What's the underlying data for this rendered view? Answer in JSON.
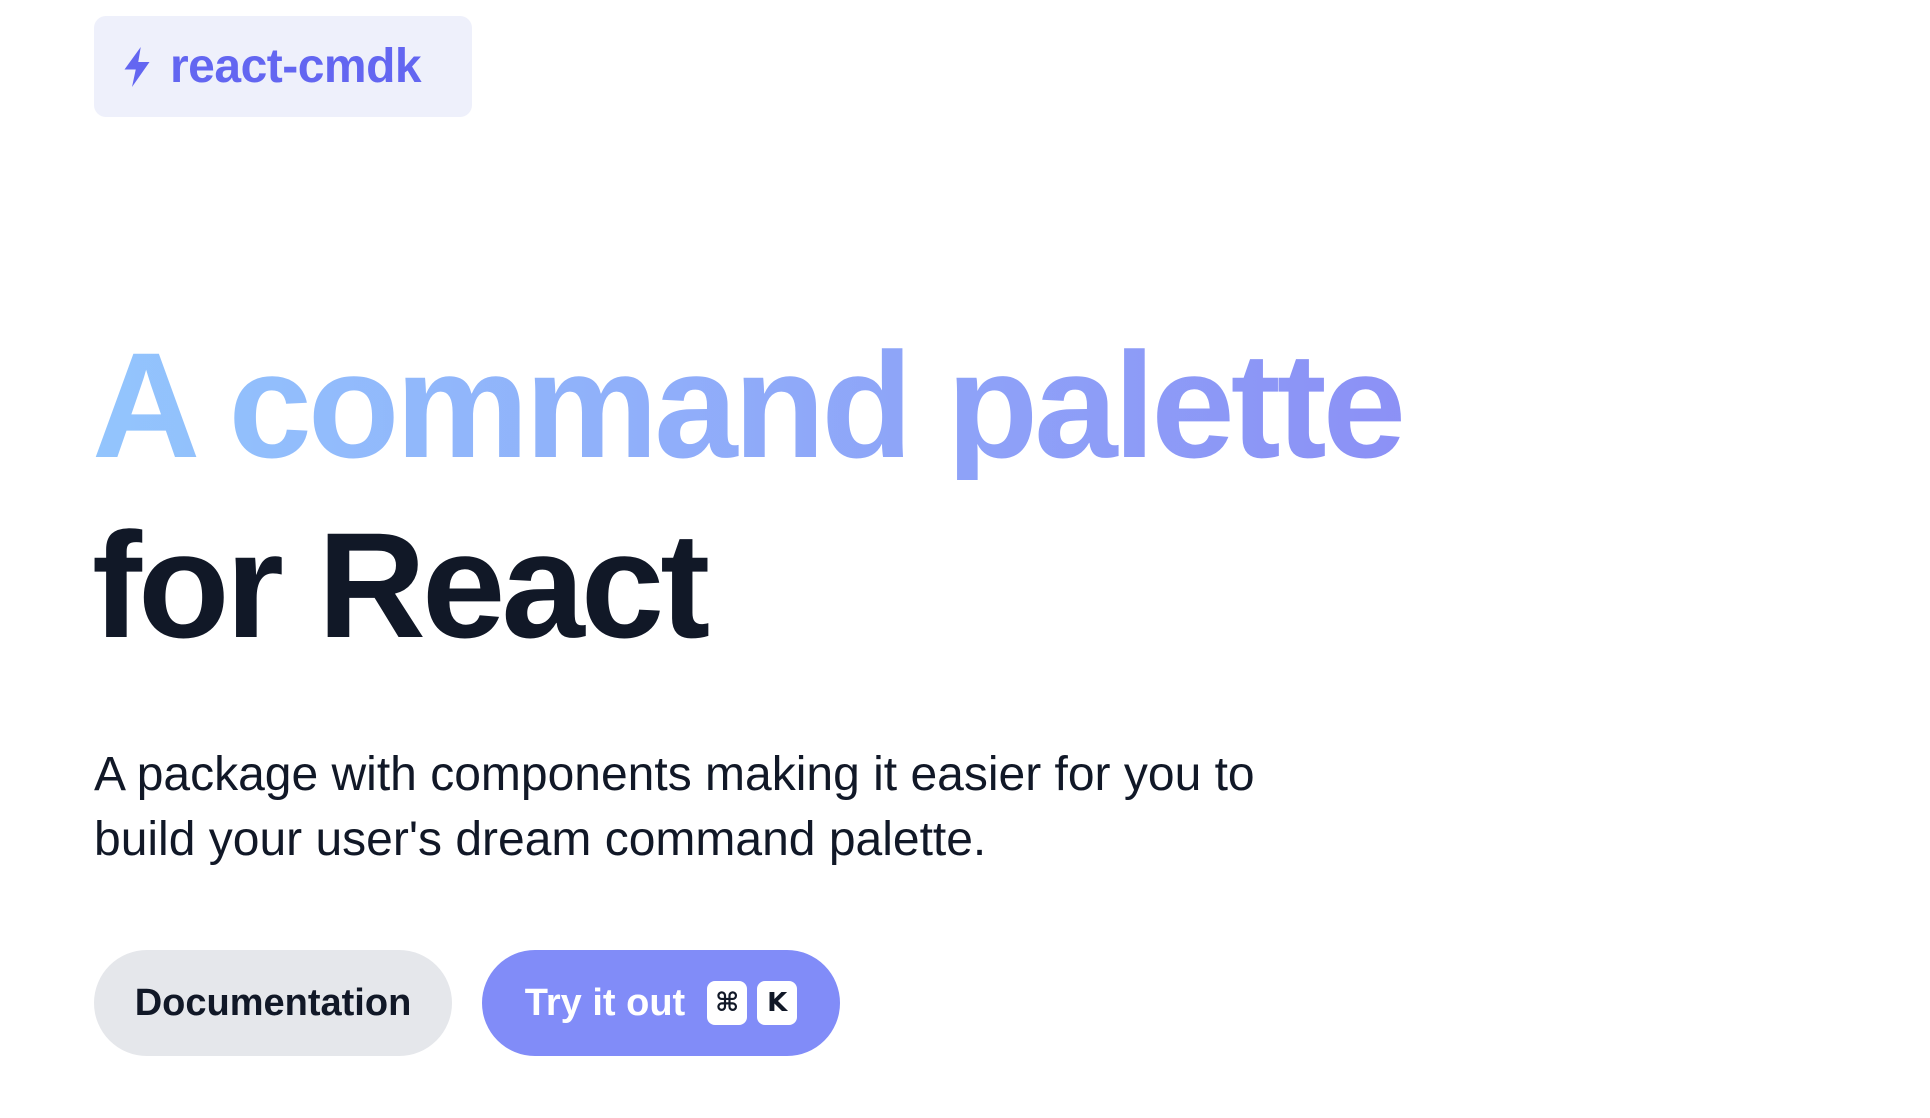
{
  "brand": {
    "icon": "lightning-bolt-icon",
    "name": "react-cmdk",
    "color": "#6366f1"
  },
  "hero": {
    "headline_line1": "A command palette",
    "headline_line2": "for React",
    "gradient_start": "#93c5fd",
    "gradient_end": "#818cf8",
    "subtitle": "A package with components making it easier for you to build your user's dream command palette."
  },
  "actions": {
    "docs_label": "Documentation",
    "try_label": "Try it out",
    "shortcut_keys": [
      "⌘",
      "K"
    ],
    "try_color": "#818cf8",
    "docs_color": "#e5e7eb"
  }
}
